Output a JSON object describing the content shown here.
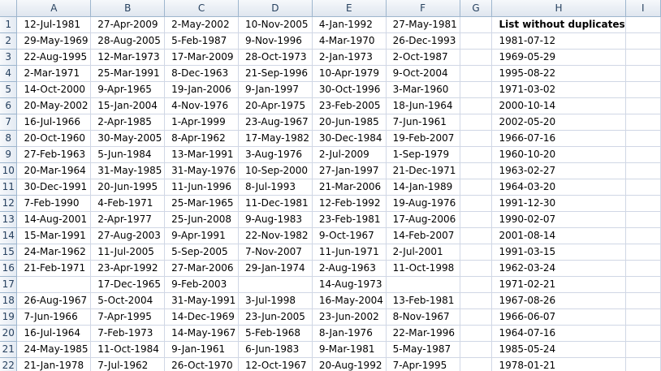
{
  "columns": [
    "A",
    "B",
    "C",
    "D",
    "E",
    "F",
    "G",
    "H",
    "I"
  ],
  "rows": [
    {
      "num": "1",
      "cells": [
        "12-Jul-1981",
        "27-Apr-2009",
        "2-May-2002",
        "10-Nov-2005",
        "4-Jan-1992",
        "27-May-1981",
        "",
        "List without duplicates",
        ""
      ]
    },
    {
      "num": "2",
      "cells": [
        "29-May-1969",
        "28-Aug-2005",
        "5-Feb-1987",
        "9-Nov-1996",
        "4-Mar-1970",
        "26-Dec-1993",
        "",
        "1981-07-12",
        ""
      ]
    },
    {
      "num": "3",
      "cells": [
        "22-Aug-1995",
        "12-Mar-1973",
        "17-Mar-2009",
        "28-Oct-1973",
        "2-Jan-1973",
        "2-Oct-1987",
        "",
        "1969-05-29",
        ""
      ]
    },
    {
      "num": "4",
      "cells": [
        "2-Mar-1971",
        "25-Mar-1991",
        "8-Dec-1963",
        "21-Sep-1996",
        "10-Apr-1979",
        "9-Oct-2004",
        "",
        "1995-08-22",
        ""
      ]
    },
    {
      "num": "5",
      "cells": [
        "14-Oct-2000",
        "9-Apr-1965",
        "19-Jan-2006",
        "9-Jan-1997",
        "30-Oct-1996",
        "3-Mar-1960",
        "",
        "1971-03-02",
        ""
      ]
    },
    {
      "num": "6",
      "cells": [
        "20-May-2002",
        "15-Jan-2004",
        "4-Nov-1976",
        "20-Apr-1975",
        "23-Feb-2005",
        "18-Jun-1964",
        "",
        "2000-10-14",
        ""
      ]
    },
    {
      "num": "7",
      "cells": [
        "16-Jul-1966",
        "2-Apr-1985",
        "1-Apr-1999",
        "23-Aug-1967",
        "20-Jun-1985",
        "7-Jun-1961",
        "",
        "2002-05-20",
        ""
      ]
    },
    {
      "num": "8",
      "cells": [
        "20-Oct-1960",
        "30-May-2005",
        "8-Apr-1962",
        "17-May-1982",
        "30-Dec-1984",
        "19-Feb-2007",
        "",
        "1966-07-16",
        ""
      ]
    },
    {
      "num": "9",
      "cells": [
        "27-Feb-1963",
        "5-Jun-1984",
        "13-Mar-1991",
        "3-Aug-1976",
        "2-Jul-2009",
        "1-Sep-1979",
        "",
        "1960-10-20",
        ""
      ]
    },
    {
      "num": "10",
      "cells": [
        "20-Mar-1964",
        "31-May-1985",
        "31-May-1976",
        "10-Sep-2000",
        "27-Jan-1997",
        "21-Dec-1971",
        "",
        "1963-02-27",
        ""
      ]
    },
    {
      "num": "11",
      "cells": [
        "30-Dec-1991",
        "20-Jun-1995",
        "11-Jun-1996",
        "8-Jul-1993",
        "21-Mar-2006",
        "14-Jan-1989",
        "",
        "1964-03-20",
        ""
      ]
    },
    {
      "num": "12",
      "cells": [
        "7-Feb-1990",
        "4-Feb-1971",
        "25-Mar-1965",
        "11-Dec-1981",
        "12-Feb-1992",
        "19-Aug-1976",
        "",
        "1991-12-30",
        ""
      ]
    },
    {
      "num": "13",
      "cells": [
        "14-Aug-2001",
        "2-Apr-1977",
        "25-Jun-2008",
        "9-Aug-1983",
        "23-Feb-1981",
        "17-Aug-2006",
        "",
        "1990-02-07",
        ""
      ]
    },
    {
      "num": "14",
      "cells": [
        "15-Mar-1991",
        "27-Aug-2003",
        "9-Apr-1991",
        "22-Nov-1982",
        "9-Oct-1967",
        "14-Feb-2007",
        "",
        "2001-08-14",
        ""
      ]
    },
    {
      "num": "15",
      "cells": [
        "24-Mar-1962",
        "11-Jul-2005",
        "5-Sep-2005",
        "7-Nov-2007",
        "11-Jun-1971",
        "2-Jul-2001",
        "",
        "1991-03-15",
        ""
      ]
    },
    {
      "num": "16",
      "cells": [
        "21-Feb-1971",
        "23-Apr-1992",
        "27-Mar-2006",
        "29-Jan-1974",
        "2-Aug-1963",
        "11-Oct-1998",
        "",
        "1962-03-24",
        ""
      ]
    },
    {
      "num": "17",
      "cells": [
        "",
        "17-Dec-1965",
        "9-Feb-2003",
        "",
        "14-Aug-1973",
        "",
        "",
        "1971-02-21",
        ""
      ]
    },
    {
      "num": "18",
      "cells": [
        "26-Aug-1967",
        "5-Oct-2004",
        "31-May-1991",
        "3-Jul-1998",
        "16-May-2004",
        "13-Feb-1981",
        "",
        "1967-08-26",
        ""
      ]
    },
    {
      "num": "19",
      "cells": [
        "7-Jun-1966",
        "7-Apr-1995",
        "14-Dec-1969",
        "23-Jun-2005",
        "23-Jun-2002",
        "8-Nov-1967",
        "",
        "1966-06-07",
        ""
      ]
    },
    {
      "num": "20",
      "cells": [
        "16-Jul-1964",
        "7-Feb-1973",
        "14-May-1967",
        "5-Feb-1968",
        "8-Jan-1976",
        "22-Mar-1996",
        "",
        "1964-07-16",
        ""
      ]
    },
    {
      "num": "21",
      "cells": [
        "24-May-1985",
        "11-Oct-1984",
        "9-Jan-1961",
        "6-Jun-1983",
        "9-Mar-1981",
        "5-May-1987",
        "",
        "1985-05-24",
        ""
      ]
    },
    {
      "num": "22",
      "cells": [
        "21-Jan-1978",
        "7-Jul-1962",
        "26-Oct-1970",
        "12-Oct-1967",
        "20-Aug-1992",
        "7-Apr-1995",
        "",
        "1978-01-21",
        ""
      ]
    }
  ]
}
